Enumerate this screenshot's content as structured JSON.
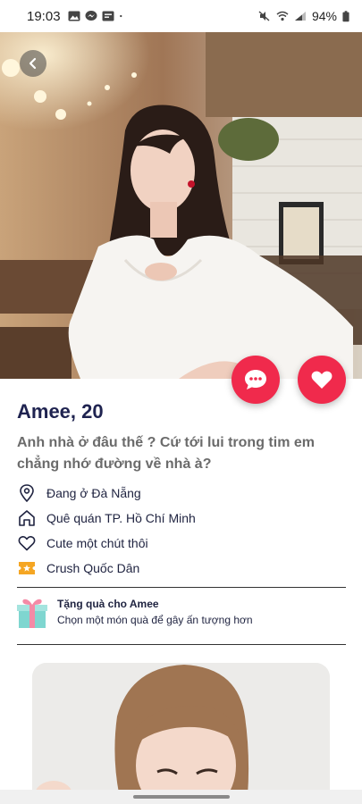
{
  "status_bar": {
    "time": "19:03",
    "left_icons": [
      "gallery-icon",
      "messenger-icon",
      "message-icon",
      "dot-icon"
    ],
    "battery": "94%",
    "right_icons": [
      "mute-icon",
      "wifi-icon",
      "signal-icon",
      "battery-icon"
    ]
  },
  "profile": {
    "name_age": "Amee, 20",
    "bio": "Anh nhà ở đâu thế ? Cứ tới lui trong tim em chẳng nhớ đường về nhà à?",
    "details": [
      {
        "icon": "location-pin-icon",
        "text": "Đang ở Đà Nẵng"
      },
      {
        "icon": "home-icon",
        "text": "Quê quán TP. Hồ Chí Minh"
      },
      {
        "icon": "heart-outline-icon",
        "text": "Cute một chút thôi"
      },
      {
        "icon": "ticket-icon",
        "text": "Crush Quốc Dân"
      }
    ]
  },
  "gift": {
    "title": "Tặng quà cho Amee",
    "subtitle": "Chọn một món quà để gây ấn tượng hơn"
  },
  "colors": {
    "accent": "#f02a4c",
    "name": "#1f2350",
    "bio": "#6b6b6b",
    "ticket": "#f5a623",
    "gift_box": "#7fd6d0",
    "gift_ribbon": "#f48aa6"
  }
}
